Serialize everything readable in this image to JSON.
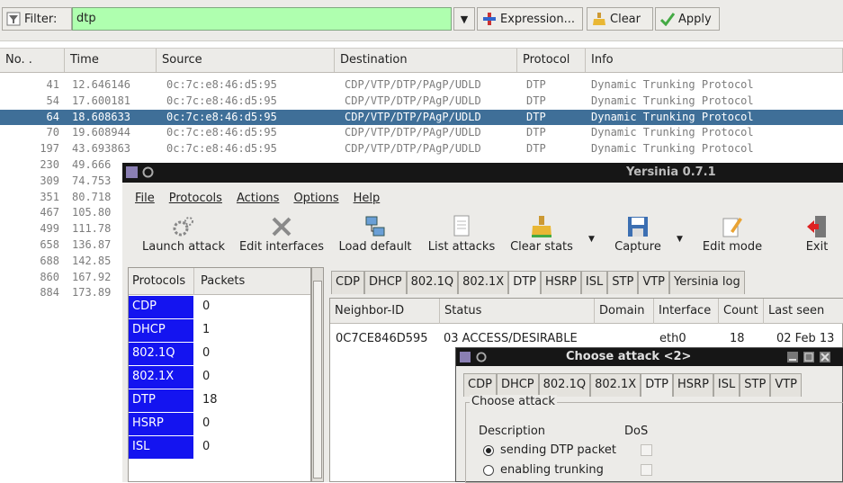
{
  "filter": {
    "label": "Filter:",
    "value": "dtp",
    "expression_label": "Expression...",
    "clear_label": "Clear",
    "apply_label": "Apply"
  },
  "packet_list": {
    "columns": [
      "No. .",
      "Time",
      "Source",
      "Destination",
      "Protocol",
      "Info"
    ],
    "rows": [
      {
        "no": "41",
        "time": "12.646146",
        "source": "0c:7c:e8:46:d5:95",
        "destination": "CDP/VTP/DTP/PAgP/UDLD",
        "protocol": "DTP",
        "info": "Dynamic Trunking Protocol"
      },
      {
        "no": "54",
        "time": "17.600181",
        "source": "0c:7c:e8:46:d5:95",
        "destination": "CDP/VTP/DTP/PAgP/UDLD",
        "protocol": "DTP",
        "info": "Dynamic Trunking Protocol"
      },
      {
        "no": "64",
        "time": "18.608633",
        "source": "0c:7c:e8:46:d5:95",
        "destination": "CDP/VTP/DTP/PAgP/UDLD",
        "protocol": "DTP",
        "info": "Dynamic Trunking Protocol",
        "selected": true
      },
      {
        "no": "70",
        "time": "19.608944",
        "source": "0c:7c:e8:46:d5:95",
        "destination": "CDP/VTP/DTP/PAgP/UDLD",
        "protocol": "DTP",
        "info": "Dynamic Trunking Protocol"
      },
      {
        "no": "197",
        "time": "43.693863",
        "source": "0c:7c:e8:46:d5:95",
        "destination": "CDP/VTP/DTP/PAgP/UDLD",
        "protocol": "DTP",
        "info": "Dynamic Trunking Protocol"
      },
      {
        "no": "230",
        "time": "49.666"
      },
      {
        "no": "309",
        "time": "74.753"
      },
      {
        "no": "351",
        "time": "80.718"
      },
      {
        "no": "467",
        "time": "105.80"
      },
      {
        "no": "499",
        "time": "111.78"
      },
      {
        "no": "658",
        "time": "136.87"
      },
      {
        "no": "688",
        "time": "142.85"
      },
      {
        "no": "860",
        "time": "167.92"
      },
      {
        "no": "884",
        "time": "173.89"
      }
    ]
  },
  "yersinia": {
    "title": "Yersinia 0.7.1",
    "menu": [
      "File",
      "Protocols",
      "Actions",
      "Options",
      "Help"
    ],
    "toolbar": [
      "Launch attack",
      "Edit interfaces",
      "Load default",
      "List attacks",
      "Clear stats",
      "Capture",
      "Edit mode",
      "Exit"
    ],
    "protocols_table": {
      "headers": [
        "Protocols",
        "Packets"
      ],
      "rows": [
        {
          "name": "CDP",
          "packets": "0"
        },
        {
          "name": "DHCP",
          "packets": "1"
        },
        {
          "name": "802.1Q",
          "packets": "0"
        },
        {
          "name": "802.1X",
          "packets": "0"
        },
        {
          "name": "DTP",
          "packets": "18"
        },
        {
          "name": "HSRP",
          "packets": "0"
        },
        {
          "name": "ISL",
          "packets": "0"
        }
      ]
    },
    "tabs": [
      "CDP",
      "DHCP",
      "802.1Q",
      "802.1X",
      "DTP",
      "HSRP",
      "ISL",
      "STP",
      "VTP",
      "Yersinia log"
    ],
    "active_tab": "DTP",
    "neighbor_table": {
      "headers": [
        "Neighbor-ID",
        "Status",
        "Domain",
        "Interface",
        "Count",
        "Last seen"
      ],
      "rows": [
        {
          "neighbor_id": "0C7CE846D595",
          "status": "03 ACCESS/DESIRABLE",
          "domain": "",
          "interface": "eth0",
          "count": "18",
          "last_seen": "02 Feb 13"
        }
      ]
    }
  },
  "choose_attack": {
    "title": "Choose attack <2>",
    "tabs": [
      "CDP",
      "DHCP",
      "802.1Q",
      "802.1X",
      "DTP",
      "HSRP",
      "ISL",
      "STP",
      "VTP"
    ],
    "active_tab": "DTP",
    "group_label": "Choose attack",
    "col_description": "Description",
    "col_dos": "DoS",
    "options": [
      {
        "label": "sending DTP packet",
        "selected": true
      },
      {
        "label": "enabling trunking",
        "selected": false
      }
    ]
  },
  "colors": {
    "filter_ok": "#afffaf",
    "selection": "#3f6f98",
    "protocol_cell": "#1414f0"
  }
}
